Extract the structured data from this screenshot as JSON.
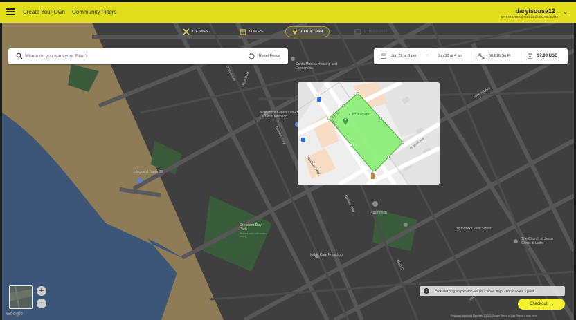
{
  "topbar": {
    "nav": [
      "Create Your Own",
      "Community Filters"
    ],
    "user_name": "darylsousa12",
    "user_email": "ORTIGERSA@KELLE@GMAIL.COM"
  },
  "steps": [
    {
      "label": "DESIGN",
      "icon": "tools-icon",
      "state": "done"
    },
    {
      "label": "DATES",
      "icon": "calendar-icon",
      "state": "done"
    },
    {
      "label": "LOCATION",
      "icon": "pin-icon",
      "state": "active"
    },
    {
      "label": "CHECKOUT",
      "icon": "checkout-icon",
      "state": "disabled"
    }
  ],
  "search": {
    "placeholder": "Where do you want your Filter?",
    "reset_label": "Reset Fence"
  },
  "info": {
    "start": "Jun 29 at 8 pm",
    "end": "Jun 30 at 4 am",
    "area": "68,616 Sq Ft",
    "price": "$7.00 USD"
  },
  "map_labels": {
    "santa_monica": "Santa Monica Housing and Economic...",
    "movement_center": "Movement Center Los Angeles | act with intention",
    "lifeguard": "Lifeguard Tower 20",
    "crescent_bay": "Crescent Bay Park",
    "crescent_bay_sub": "Shaded park with ocean views",
    "kiddy_kare": "Kiddy Kare Preschool",
    "yogaworks": "YogaWorks Main Street",
    "church": "The Church of Jesus Christ of Latter",
    "plasmonith": "Plasmonith",
    "ocean_ave": "Ocean Ave",
    "pico_blvd": "Pico Blvd",
    "neilson_way": "Neilson Way",
    "main_st": "Main St",
    "bay_st": "Bay St",
    "bicknell_ave": "Bicknell Ave",
    "pacific_st": "Pacific St"
  },
  "preview": {
    "place": "Circuit Works",
    "streets": [
      "Bay St",
      "Main St",
      "Bicknell Ave",
      "Neilson Way"
    ],
    "fence_color": "#8ef07a"
  },
  "zoom": {
    "plus": "+",
    "minus": "−"
  },
  "tip": "Click and drag on points to edit your fence. Right click to delete a point.",
  "checkout_label": "Checkout",
  "attribution": "Keyboard shortcuts   Map data ©2022 Google   Terms of Use   Report a map error",
  "google": "Google",
  "colors": {
    "accent": "#f6f231",
    "topbar": "#e3de1c",
    "fence": "#8ef07a"
  }
}
